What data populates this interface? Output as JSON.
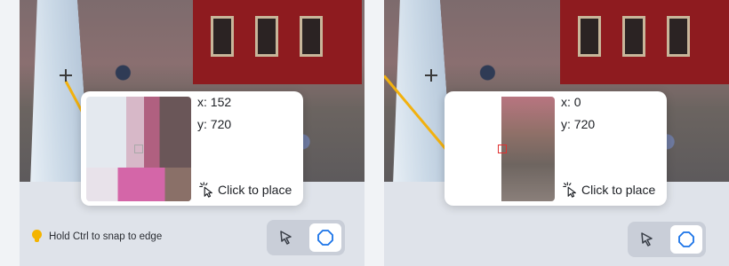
{
  "colors": {
    "accent": "#1a73e8",
    "guide_line": "#f2b10e",
    "marker_red": "#e03030",
    "hint_bulb": "#f4b400"
  },
  "left_panel": {
    "popover": {
      "x_label": "x: 152",
      "y_label": "y: 720",
      "click_hint": "Click to place"
    },
    "hint_text": "Hold Ctrl to snap to edge",
    "tools": {
      "select_icon": "cursor-arrow-icon",
      "polygon_icon": "octagon-icon",
      "active": "polygon"
    }
  },
  "right_panel": {
    "popover": {
      "x_label": "x: 0",
      "y_label": "y: 720",
      "click_hint": "Click to place"
    },
    "tools": {
      "select_icon": "cursor-arrow-icon",
      "polygon_icon": "octagon-icon",
      "active": "polygon"
    }
  }
}
